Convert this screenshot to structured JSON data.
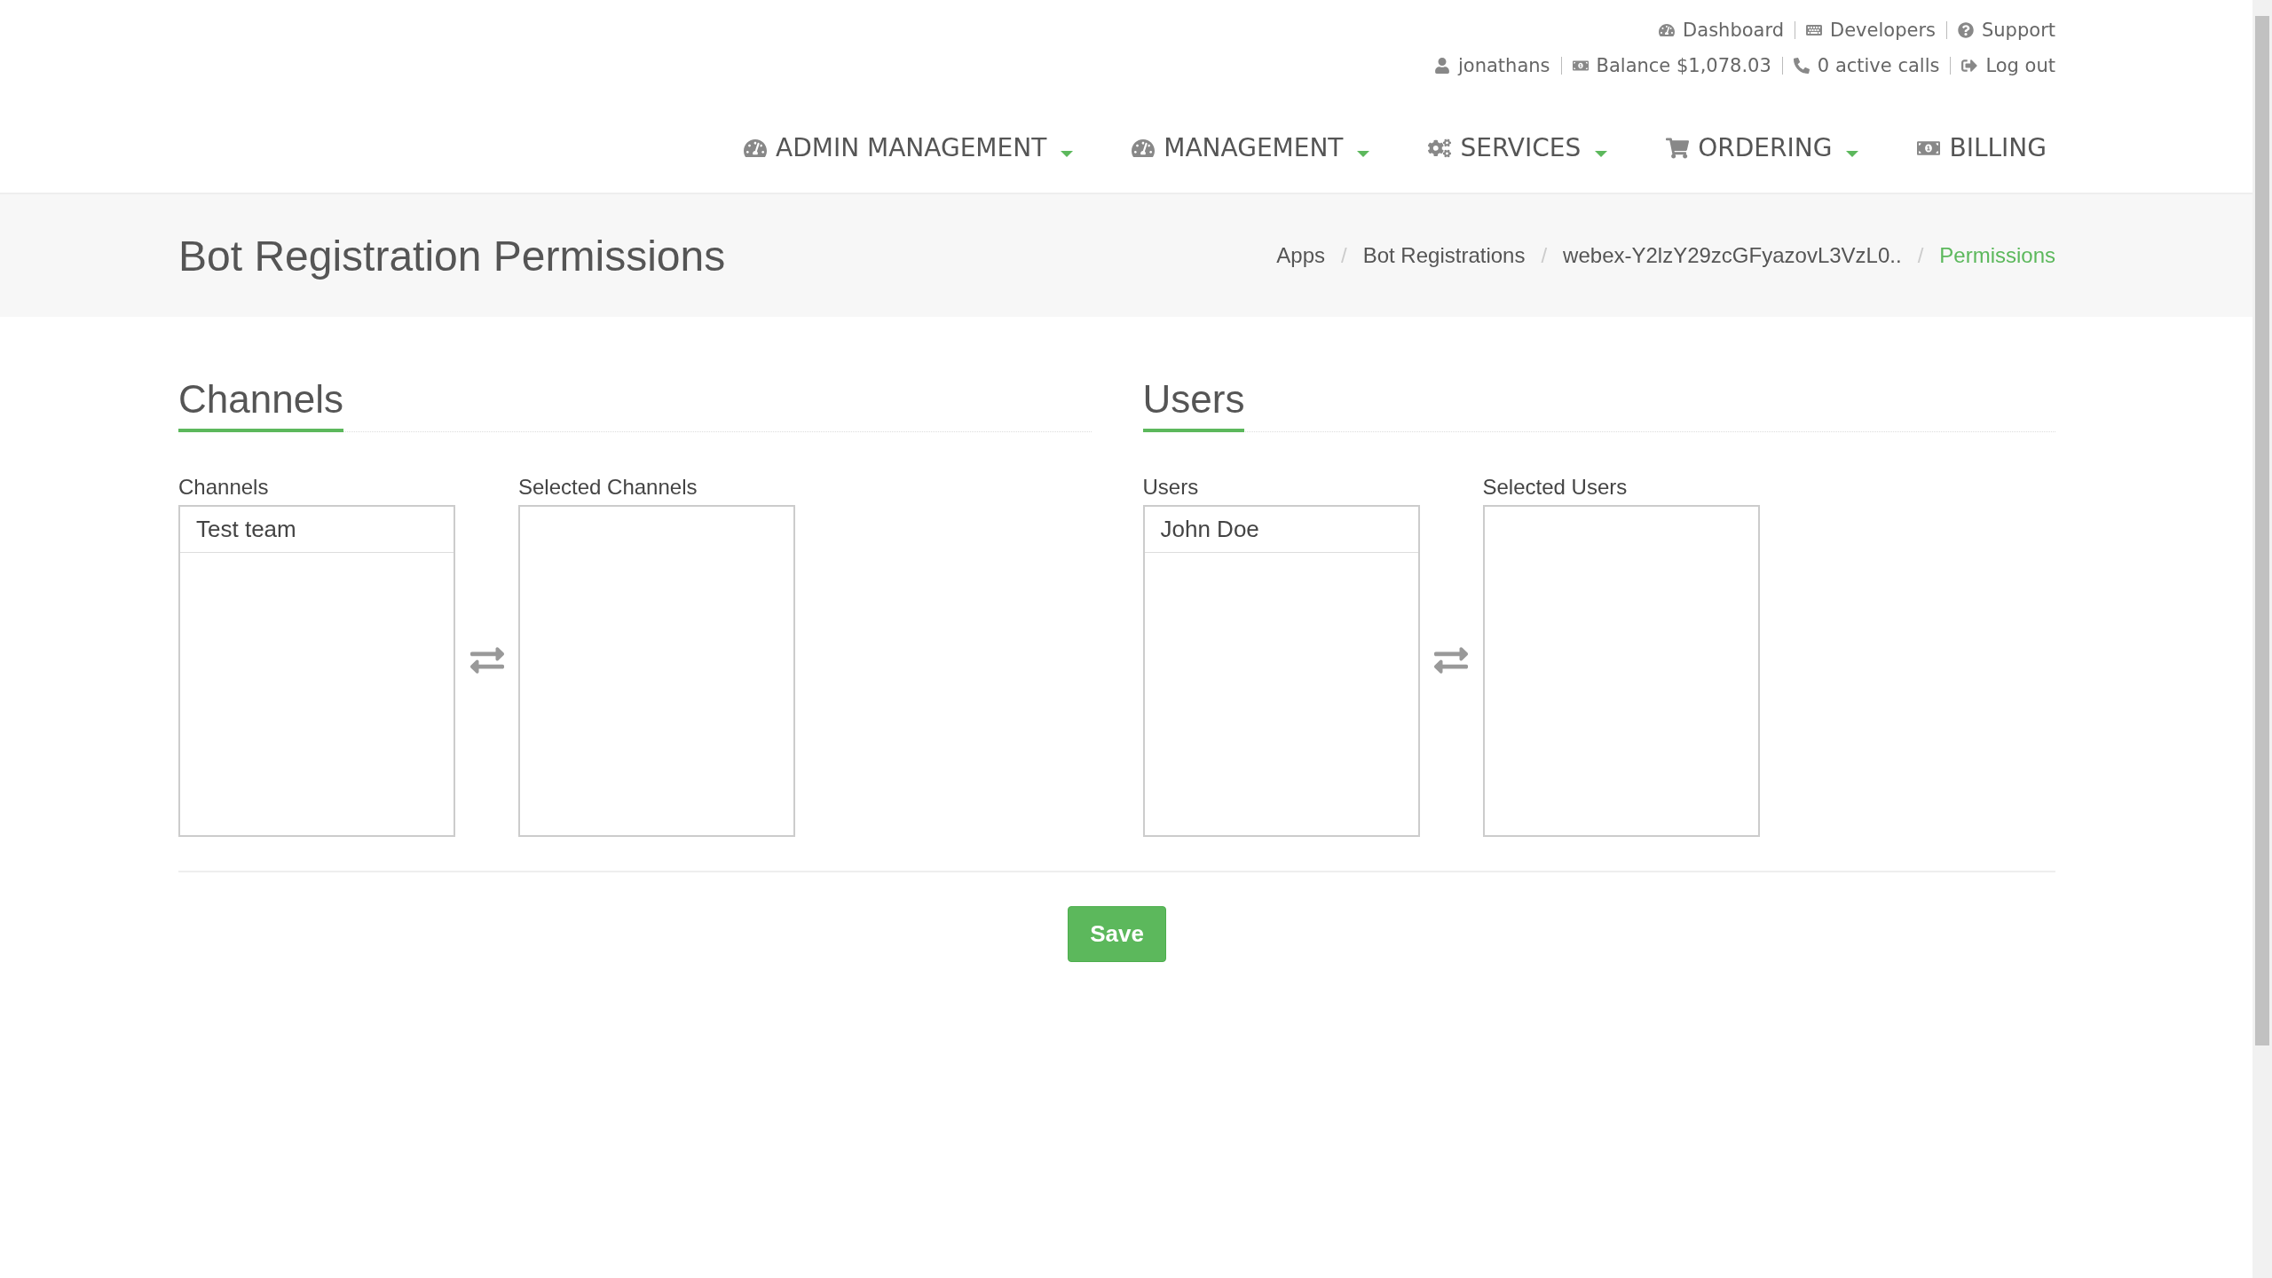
{
  "top_links": {
    "row_1": [
      "Dashboard",
      "Developers",
      "Support"
    ],
    "row_2": [
      "jonathans",
      "Balance $1,078.03",
      "0 active calls",
      "Log out"
    ]
  },
  "nav": [
    {
      "label": "ADMIN MANAGEMENT",
      "dropdown": true
    },
    {
      "label": "MANAGEMENT",
      "dropdown": true
    },
    {
      "label": "SERVICES",
      "dropdown": true
    },
    {
      "label": "ORDERING",
      "dropdown": true
    },
    {
      "label": "BILLING",
      "dropdown": false
    }
  ],
  "page_title": "Bot Registration Permissions",
  "breadcrumb_separator": "/",
  "breadcrumb": [
    {
      "label": "Apps",
      "active": false
    },
    {
      "label": "Bot Registrations",
      "active": false
    },
    {
      "label": "webex-Y2lzY29zcGFyazovL3VzL0..",
      "active": false
    },
    {
      "label": "Permissions",
      "active": true
    }
  ],
  "sections": [
    {
      "heading": "Channels",
      "available": {
        "label": "Channels",
        "items": [
          "Test team"
        ]
      },
      "selected": {
        "label": "Selected Channels"
      }
    },
    {
      "heading": "Users",
      "available": {
        "label": "Users",
        "items": [
          "John Doe"
        ]
      },
      "selected": {
        "label": "Selected Users"
      }
    }
  ],
  "save_button": "Save"
}
